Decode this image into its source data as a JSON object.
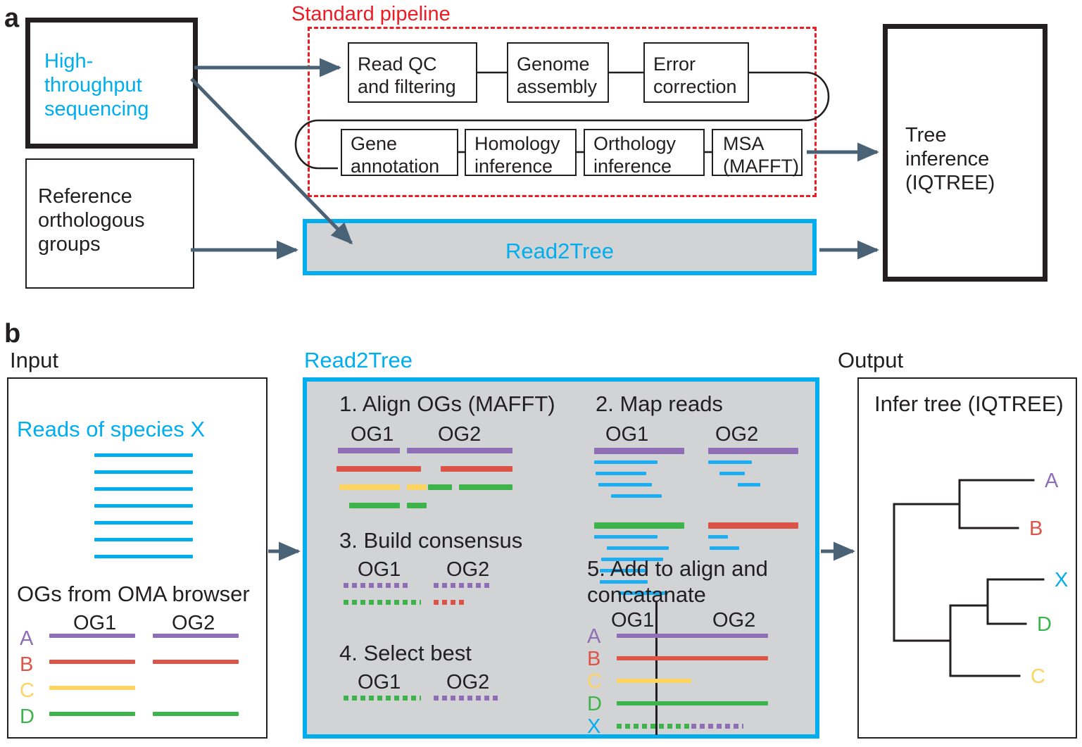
{
  "figure": {
    "panel_a_letter": "a",
    "panel_b_letter": "b"
  },
  "panel_a": {
    "input_boxes": [
      {
        "name": "high-throughput-sequencing",
        "label": "High-\nthroughput\nsequencing",
        "color": "#00AEEF"
      },
      {
        "name": "reference-orthologous-groups",
        "label": "Reference\northologous\ngroups",
        "color": "#231f20"
      }
    ],
    "standard_pipeline": {
      "title": "Standard pipeline",
      "title_color": "#ED1C24",
      "row1": [
        "Read QC\nand filtering",
        "Genome\nassembly",
        "Error\ncorrection"
      ],
      "row2": [
        "Gene\nannotation",
        "Homology\ninference",
        "Orthology\ninference",
        "MSA\n(MAFFT)"
      ]
    },
    "read2tree_box": {
      "label": "Read2Tree",
      "label_color": "#00AEEF",
      "fill": "#d2d3d4",
      "border": "#00AEEF"
    },
    "output_box": {
      "label": "Tree\ninference\n(IQTREE)"
    },
    "arrow_color": "#4a6275"
  },
  "panel_b": {
    "input": {
      "heading": "Input",
      "reads_title": "Reads of species X",
      "reads_color": "#00AEEF",
      "reads_count": 7,
      "ogs_title": "OGs from OMA browser",
      "og_headers": [
        "OG1",
        "OG2"
      ],
      "species": [
        {
          "label": "A",
          "color": "#8e6fb5"
        },
        {
          "label": "B",
          "color": "#dd5448"
        },
        {
          "label": "C",
          "color": "#fcd462"
        },
        {
          "label": "D",
          "color": "#3cb44b"
        }
      ],
      "og1_rows": [
        true,
        true,
        true,
        true
      ],
      "og2_rows": [
        true,
        true,
        false,
        true
      ]
    },
    "read2tree": {
      "heading": "Read2Tree",
      "heading_color": "#00AEEF",
      "fill": "#d2d3d4",
      "border": "#00AEEF",
      "steps": [
        {
          "num": "1.",
          "title": "1. Align OGs (MAFFT)"
        },
        {
          "num": "2.",
          "title": "2. Map reads"
        },
        {
          "num": "3.",
          "title": "3. Build consensus"
        },
        {
          "num": "4.",
          "title": "4. Select best"
        },
        {
          "num": "5.",
          "title": "5. Add to align and\nconcatanate"
        }
      ],
      "step1": {
        "og_headers": [
          "OG1",
          "OG2"
        ],
        "og1": [
          {
            "color": "#8e6fb5",
            "parts": [
              [
                0,
                88
              ],
              [
                98,
                32
              ]
            ]
          },
          {
            "color": "#db5247",
            "parts": [
              [
                -2,
                120
              ]
            ]
          },
          {
            "color": "#fcd462",
            "parts": [
              [
                2,
                86
              ],
              [
                98,
                28
              ]
            ]
          },
          {
            "color": "#3cb44b",
            "parts": [
              [
                16,
                72
              ],
              [
                98,
                28
              ]
            ]
          }
        ],
        "og2": [
          {
            "color": "#8e6fb5",
            "parts": [
              [
                0,
                120
              ]
            ]
          },
          {
            "color": "#db5247",
            "parts": [
              [
                18,
                102
              ]
            ]
          },
          {
            "color": "#3cb44b",
            "parts": [
              [
                0,
                34
              ],
              [
                44,
                76
              ]
            ]
          }
        ]
      },
      "step2": {
        "og_headers": [
          "OG1",
          "OG2"
        ],
        "og1_ref_colors": [
          "#8e6fb5",
          "#3cb44b"
        ],
        "og2_ref_colors": [
          "#8e6fb5",
          "#db5247"
        ],
        "read_color": "#1DAEF2",
        "og1_block1_reads": [
          [
            0,
            90
          ],
          [
            2,
            72
          ],
          [
            6,
            76
          ],
          [
            24,
            72
          ]
        ],
        "og1_block2_reads": [
          [
            0,
            90
          ],
          [
            18,
            88
          ],
          [
            10,
            88
          ],
          [
            8,
            68
          ],
          [
            8,
            68
          ],
          [
            34,
            70
          ]
        ],
        "og2_block1_reads": [
          [
            0,
            62
          ],
          [
            16,
            36
          ],
          [
            42,
            32
          ]
        ],
        "og2_block2_reads": [
          [
            0,
            28
          ],
          [
            2,
            42
          ]
        ]
      },
      "step3": {
        "og_headers": [
          "OG1",
          "OG2"
        ],
        "og1": [
          {
            "color": "#8e6fb5",
            "len": 96
          },
          {
            "color": "#3cb44b",
            "len": 110
          }
        ],
        "og2": [
          {
            "color": "#8e6fb5",
            "len": 82
          },
          {
            "color": "#db5247",
            "len": 46
          }
        ]
      },
      "step4": {
        "og_headers": [
          "OG1",
          "OG2"
        ],
        "og1": {
          "color": "#3cb44b",
          "len": 110
        },
        "og2": {
          "color": "#8e6fb5",
          "len": 92
        }
      },
      "step5": {
        "og_headers": [
          "OG1",
          "OG2"
        ],
        "rows": [
          {
            "label": "A",
            "color": "#8e6fb5",
            "style": "solid",
            "len": 215
          },
          {
            "label": "B",
            "color": "#dd5448",
            "style": "solid",
            "len": 215
          },
          {
            "label": "C",
            "color": "#fcd462",
            "style": "solid",
            "len": 106
          },
          {
            "label": "D",
            "color": "#3cb44b",
            "style": "solid",
            "len": 215
          },
          {
            "label": "X",
            "color": "#00AEEF",
            "style": "split",
            "len": 180,
            "left_color": "#3cb44b",
            "right_color": "#8e6fb5",
            "split_at": 106
          }
        ]
      }
    },
    "output": {
      "heading": "Output",
      "tree_title": "Infer tree (IQTREE)",
      "tips": [
        {
          "label": "A",
          "color": "#8e6fb5"
        },
        {
          "label": "B",
          "color": "#dd5448"
        },
        {
          "label": "X",
          "color": "#00AEEF"
        },
        {
          "label": "D",
          "color": "#3cb44b"
        },
        {
          "label": "C",
          "color": "#fcd462"
        }
      ]
    },
    "arrow_color": "#4a6275"
  }
}
